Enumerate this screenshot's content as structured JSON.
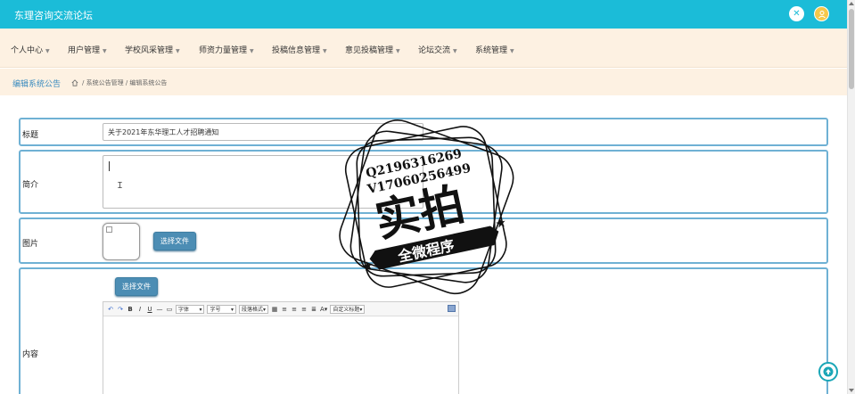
{
  "header": {
    "brand": "东理咨询交流论坛",
    "close_icon": "✕",
    "user_icon": "user-icon"
  },
  "nav": {
    "items": [
      {
        "label": "个人中心"
      },
      {
        "label": "用户管理"
      },
      {
        "label": "学校风采管理"
      },
      {
        "label": "师资力量管理"
      },
      {
        "label": "投稿信息管理"
      },
      {
        "label": "意见投稿管理"
      },
      {
        "label": "论坛交流"
      },
      {
        "label": "系统管理"
      }
    ]
  },
  "breadcrumb": {
    "title": "编辑系统公告",
    "path": [
      "系统公告管理",
      "编辑系统公告"
    ],
    "separator": "/"
  },
  "form": {
    "title_label": "标题",
    "title_value": "关于2021年东华理工人才招聘通知",
    "summary_label": "简介",
    "image_label": "图片",
    "image_button": "选择文件",
    "content_label": "内容",
    "content_button": "选择文件"
  },
  "editor_toolbar": {
    "bold": "B",
    "italic": "I",
    "underline": "U",
    "font_family": "字体",
    "font_size": "字号",
    "paragraph": "段落格式",
    "font_color": "A",
    "custom_title": "自定义标题"
  },
  "watermark": {
    "line1": "Q2196316269",
    "line2": "V17060256499",
    "main": "实拍",
    "banner": "全微程序"
  },
  "colors": {
    "header_bg": "#1bbcd8",
    "nav_bg": "#fdf1e2",
    "row_border": "#6fb1d4",
    "button_bg": "#4c8db4",
    "link": "#3a8bbf"
  }
}
